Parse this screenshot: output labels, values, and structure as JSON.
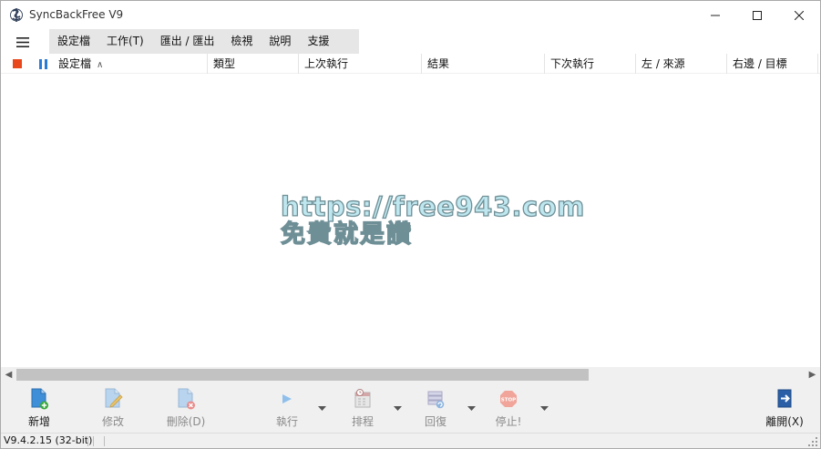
{
  "window": {
    "title": "SyncBackFree V9"
  },
  "menu": {
    "items": [
      {
        "label": "設定檔"
      },
      {
        "label": "工作(T)"
      },
      {
        "label": "匯出 / 匯出"
      },
      {
        "label": "檢視"
      },
      {
        "label": "說明"
      },
      {
        "label": "支援"
      }
    ]
  },
  "columns": {
    "profile": "設定檔",
    "type": "類型",
    "last_run": "上次執行",
    "result": "結果",
    "next_run": "下次執行",
    "left_source": "左 / 來源",
    "right_target": "右邊 / 目標"
  },
  "watermark": {
    "line1": "https://free943.com",
    "line2": "免費就是讚"
  },
  "toolbar": {
    "new": "新增",
    "modify": "修改",
    "delete": "刪除(D)",
    "run": "執行",
    "schedule": "排程",
    "restore": "回復",
    "stop": "停止!",
    "exit": "離開(X)"
  },
  "status": {
    "version": "V9.4.2.15 (32-bit)"
  },
  "colors": {
    "stop_indicator": "#e8481c",
    "pause_indicator": "#2a7bd6",
    "menu_strip": "#e6e6e6",
    "toolbar_bg": "#f0f0f0"
  },
  "icons": {
    "app": "syncback-app-icon",
    "stop": "stop-square-icon",
    "pause": "pause-icon",
    "sort": "sort-ascending-icon"
  }
}
